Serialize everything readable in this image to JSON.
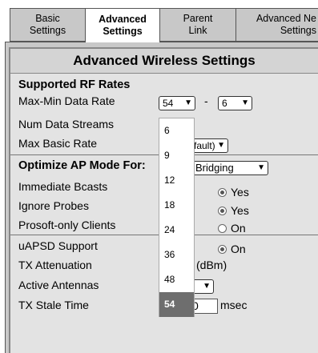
{
  "tabs": [
    {
      "line1": "Basic",
      "line2": "Settings"
    },
    {
      "line1": "Advanced",
      "line2": "Settings"
    },
    {
      "line1": "Parent",
      "line2": "Link"
    },
    {
      "line1": "Advanced Ne",
      "line2": "Settings"
    }
  ],
  "page_title": "Advanced Wireless Settings",
  "rf_rates": {
    "heading": "Supported RF Rates",
    "max_min_label": "Max-Min Data Rate",
    "max_value": "54",
    "separator": "-",
    "min_value": "6",
    "num_streams_label": "Num Data Streams",
    "max_basic_label": "Max Basic Rate",
    "max_basic_value": "fault)"
  },
  "ap_mode": {
    "heading": "Optimize AP Mode For:",
    "mode_value": "Bridging",
    "immediate_label": "Immediate Bcasts",
    "immediate_value": "Yes",
    "ignore_label": "Ignore Probes",
    "ignore_value": "Yes",
    "prosoft_label": "Prosoft-only Clients",
    "prosoft_value": "On"
  },
  "misc": {
    "uapsd_label": "uAPSD Support",
    "uapsd_value": "On",
    "tx_atten_label": "TX Attenuation",
    "tx_atten_unit": "(dBm)",
    "antennas_label": "Active Antennas",
    "tx_stale_label": "TX Stale Time",
    "tx_stale_value": "0",
    "tx_stale_unit": "msec"
  },
  "dropdown_options": [
    "6",
    "9",
    "12",
    "18",
    "24",
    "36",
    "48",
    "54"
  ],
  "dropdown_selected": "54"
}
